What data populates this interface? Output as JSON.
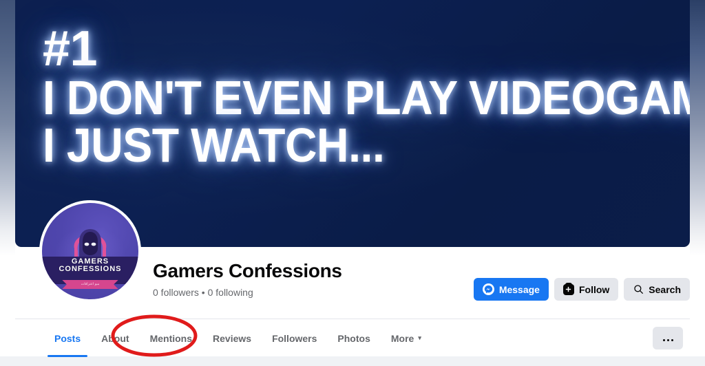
{
  "cover": {
    "name": "cover-photo",
    "lines": [
      "#1",
      "I DON'T EVEN PLAY VIDEOGAMES,",
      "I JUST WATCH..."
    ],
    "background_color": "#0c2052"
  },
  "profile": {
    "picture": {
      "band_line1": "GAMERS",
      "band_line2": "CONFESSIONS",
      "ribbon_text": "مبو اعترافات",
      "background_color": "#4f46ad"
    },
    "title": "Gamers Confessions",
    "stats": "0 followers • 0 following"
  },
  "actions": [
    {
      "label": "Message",
      "icon": "messenger-icon",
      "style": "primary",
      "color": "#1877f2"
    },
    {
      "label": "Follow",
      "icon": "follow-plus-icon",
      "style": "secondary",
      "color": "#e4e6eb"
    },
    {
      "label": "Search",
      "icon": "search-icon",
      "style": "secondary",
      "color": "#e4e6eb"
    }
  ],
  "tabs": [
    {
      "label": "Posts",
      "active": true
    },
    {
      "label": "About",
      "active": false
    },
    {
      "label": "Mentions",
      "active": false
    },
    {
      "label": "Reviews",
      "active": false
    },
    {
      "label": "Followers",
      "active": false
    },
    {
      "label": "Photos",
      "active": false
    },
    {
      "label": "More",
      "active": false,
      "caret": "▾"
    }
  ],
  "more_options_button": {
    "label": "•••",
    "name": "more-options-button"
  },
  "annotation": {
    "shape": "ellipse",
    "color": "#e01b1b",
    "target_tab": "Mentions"
  },
  "theme": {
    "accent": "#1877f2",
    "text_primary": "#050505",
    "text_secondary": "#65676b",
    "surface": "#ffffff",
    "page_background": "#f0f2f5",
    "button_secondary": "#e4e6eb"
  }
}
